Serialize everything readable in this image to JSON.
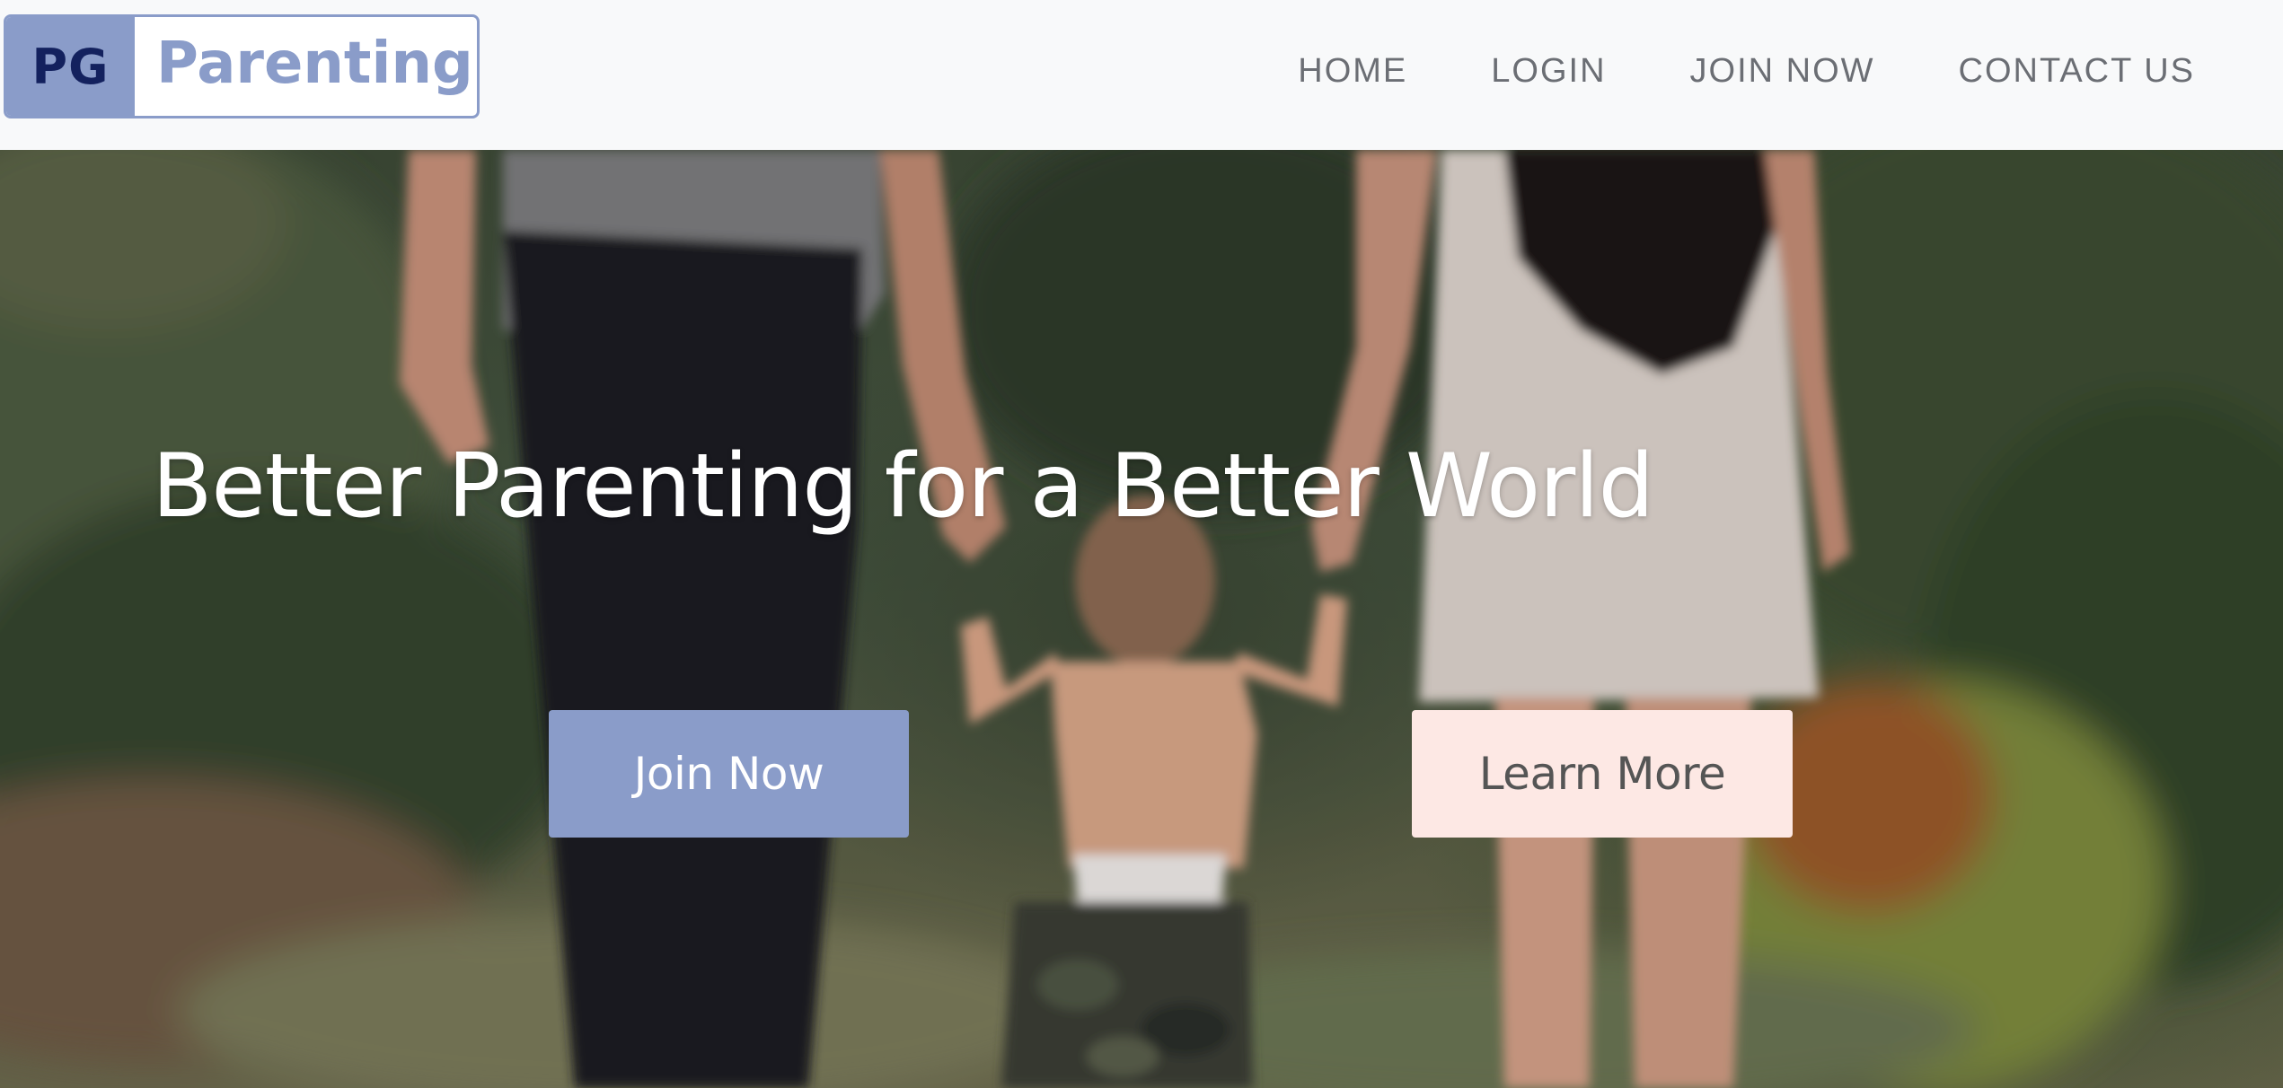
{
  "brand": {
    "mark": "PG",
    "name": "Parenting"
  },
  "nav": {
    "items": [
      {
        "label": "HOME"
      },
      {
        "label": "LOGIN"
      },
      {
        "label": "JOIN NOW"
      },
      {
        "label": "CONTACT US"
      }
    ]
  },
  "hero": {
    "title": "Better Parenting for a Better World",
    "primary_button": "Join Now",
    "secondary_button": "Learn More",
    "image": "family-walking-photo"
  },
  "colors": {
    "brand": "#8a9cc9",
    "brand_dark": "#13215e",
    "secondary_button_bg": "#fde8e4",
    "nav_text": "#6b6e74",
    "navbar_bg": "#f8f9fa"
  }
}
